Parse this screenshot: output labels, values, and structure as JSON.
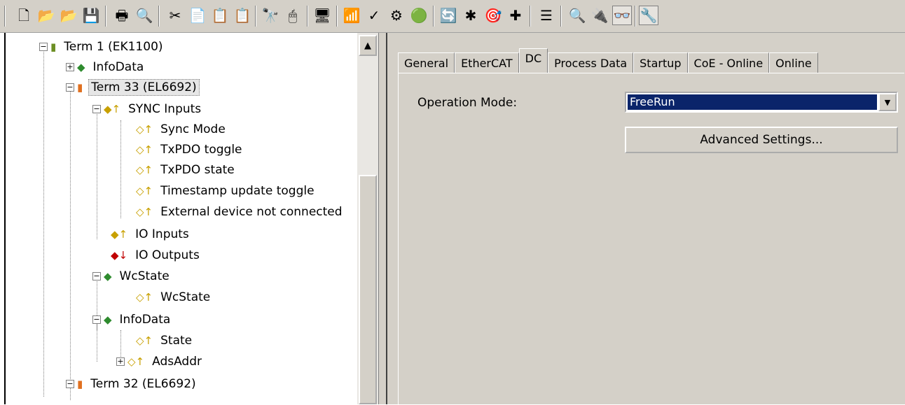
{
  "toolbar": {
    "icons": [
      "new-file-icon",
      "open-file-icon",
      "open-project-icon",
      "save-icon",
      "print-icon",
      "print-preview-icon",
      "cut-icon",
      "copy-icon",
      "paste-icon",
      "paste-special-icon",
      "find-icon",
      "mouse-icon",
      "monitor-icon",
      "network-icon",
      "check-icon",
      "build-icon",
      "activate-icon",
      "restart-icon",
      "reload-icon",
      "scan-icon",
      "stop-icon",
      "add-icon",
      "list-icon",
      "zoom-icon",
      "online-icon",
      "glasses-icon",
      "link-icon"
    ],
    "glyphs": [
      "🗋",
      "📂",
      "📂",
      "💾",
      "🖶",
      "🔍",
      "✂",
      "📄",
      "📋",
      "📋",
      "🔭",
      "🖱",
      "🖥",
      "📶",
      "✓",
      "⚙",
      "🟢",
      "🔄",
      "✱",
      "🎯",
      "✚",
      "☰",
      "🔍",
      "🔌",
      "👓",
      "🔧"
    ]
  },
  "tree": {
    "items": [
      {
        "label": "Term 1 (EK1100)",
        "icon": "terminal-icon"
      },
      {
        "label": "InfoData",
        "icon": "green-group-icon"
      },
      {
        "label": "Term 33 (EL6692)",
        "icon": "terminal-icon"
      },
      {
        "label": "SYNC Inputs",
        "icon": "yellow-input-group-icon"
      },
      {
        "label": "Sync Mode",
        "icon": "input-var-icon"
      },
      {
        "label": "TxPDO toggle",
        "icon": "input-var-icon"
      },
      {
        "label": "TxPDO state",
        "icon": "input-var-icon"
      },
      {
        "label": "Timestamp update toggle",
        "icon": "input-var-icon"
      },
      {
        "label": "External device not connected",
        "icon": "input-var-icon"
      },
      {
        "label": "IO Inputs",
        "icon": "yellow-input-group-icon"
      },
      {
        "label": "IO Outputs",
        "icon": "red-output-group-icon"
      },
      {
        "label": "WcState",
        "icon": "green-group-icon"
      },
      {
        "label": "WcState",
        "icon": "input-var-icon"
      },
      {
        "label": "InfoData",
        "icon": "green-group-icon"
      },
      {
        "label": "State",
        "icon": "input-var-icon"
      },
      {
        "label": "AdsAddr",
        "icon": "input-var-icon"
      },
      {
        "label": "Term 32 (EL6692)",
        "icon": "terminal-icon"
      }
    ]
  },
  "tabs": [
    "General",
    "EtherCAT",
    "DC",
    "Process Data",
    "Startup",
    "CoE - Online",
    "Online"
  ],
  "active_tab": "DC",
  "dc": {
    "operation_mode_label": "Operation Mode:",
    "operation_mode_value": "FreeRun",
    "advanced_button": "Advanced Settings..."
  },
  "colors": {
    "selection": "#0a246a",
    "face": "#d4d0c8"
  }
}
